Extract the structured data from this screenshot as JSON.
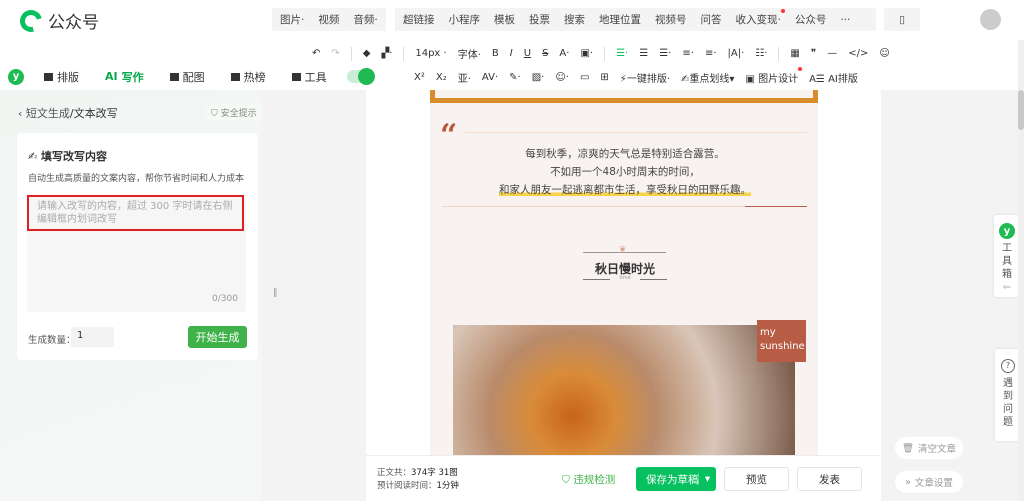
{
  "app": {
    "title": "公众号"
  },
  "nav": {
    "group1": [
      "图片·",
      "视频",
      "音频·"
    ],
    "group2": [
      "超链接",
      "小程序",
      "模板",
      "投票",
      "搜索",
      "地理位置",
      "视频号",
      "问答",
      "收入变现·",
      "公众号",
      "···"
    ]
  },
  "toolbar": {
    "font_size": "14px ·",
    "font_family": "字体·",
    "bold": "B",
    "italic": "I",
    "underline": "U",
    "strike": "S",
    "color": "A·",
    "superscript": "X²",
    "subscript": "X₂",
    "one_click_layout": "一键排版·",
    "highlight_line": "重点划线▾",
    "image_design": "图片设计",
    "ai_layout": "AI排版",
    "quote": "❞",
    "hr": "—",
    "code": "</>"
  },
  "left_tabs": [
    {
      "label": "排版"
    },
    {
      "label": "写作",
      "active": true
    },
    {
      "label": "配图"
    },
    {
      "label": "热榜"
    },
    {
      "label": "工具"
    }
  ],
  "panel": {
    "breadcrumb_parent": "短文生成",
    "breadcrumb_current": "/文本改写",
    "safety_tip": "安全提示",
    "card_title": "填写改写内容",
    "card_desc": "自动生成高质量的文案内容，帮你节省时间和人力成本",
    "input_placeholder": "请输入改写的内容，超过 300 字时请在右侧编辑框内划词改写",
    "char_count": "0/300",
    "quantity_label": "生成数量：",
    "quantity_value": "1",
    "generate_button": "开始生成"
  },
  "article": {
    "lines": [
      "每到秋季，凉爽的天气总是特别适合露营。",
      "不如用一个48小时周末的时间，",
      "和家人朋友一起逃离都市生活，享受秋日的田野乐趣。"
    ],
    "section_title": "秋日慢时光",
    "section_sub": "time",
    "badge": "my sunshine"
  },
  "footer": {
    "word_count_label": "正文共：",
    "word_count": "374字 31图",
    "read_time_label": "预计阅读时间：",
    "read_time": "1分钟",
    "check": "违规检测",
    "save_draft": "保存为草稿",
    "preview": "预览",
    "publish": "发表"
  },
  "side": {
    "toolbox": "工具箱",
    "help": "遇到问题",
    "clear": "清空文章",
    "settings": "文章设置"
  },
  "colors": {
    "accent": "#07c160",
    "frame": "#d98c2a",
    "badge": "#b85c45"
  }
}
